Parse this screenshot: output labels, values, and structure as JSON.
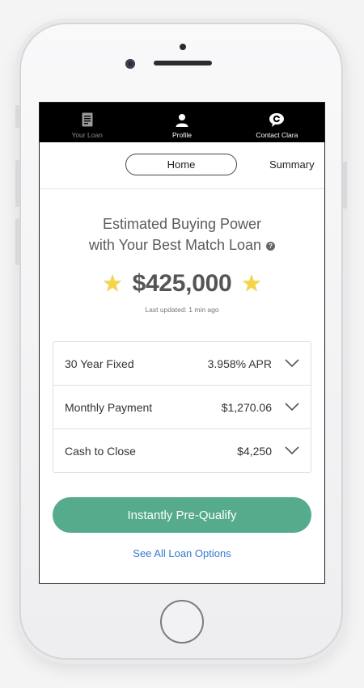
{
  "nav": {
    "items": [
      {
        "label": "Your Loan",
        "icon": "document-icon"
      },
      {
        "label": "Profile",
        "icon": "person-icon"
      },
      {
        "label": "Contact Clara",
        "icon": "chat-bubble-icon"
      }
    ]
  },
  "tabs": {
    "home": "Home",
    "summary": "Summary"
  },
  "hero": {
    "title_line1": "Estimated Buying Power",
    "title_line2": "with Your Best Match Loan",
    "amount": "$425,000",
    "updated": "Last updated: 1 min ago"
  },
  "loan": {
    "rows": [
      {
        "label": "30 Year Fixed",
        "value": "3.958% APR"
      },
      {
        "label": "Monthly Payment",
        "value": "$1,270.06"
      },
      {
        "label": "Cash to Close",
        "value": "$4,250"
      }
    ]
  },
  "actions": {
    "prequalify": "Instantly Pre-Qualify",
    "see_all": "See All Loan Options"
  },
  "colors": {
    "accent_green": "#55ab8c",
    "link_blue": "#3478d2",
    "star_yellow": "#f5d547"
  }
}
